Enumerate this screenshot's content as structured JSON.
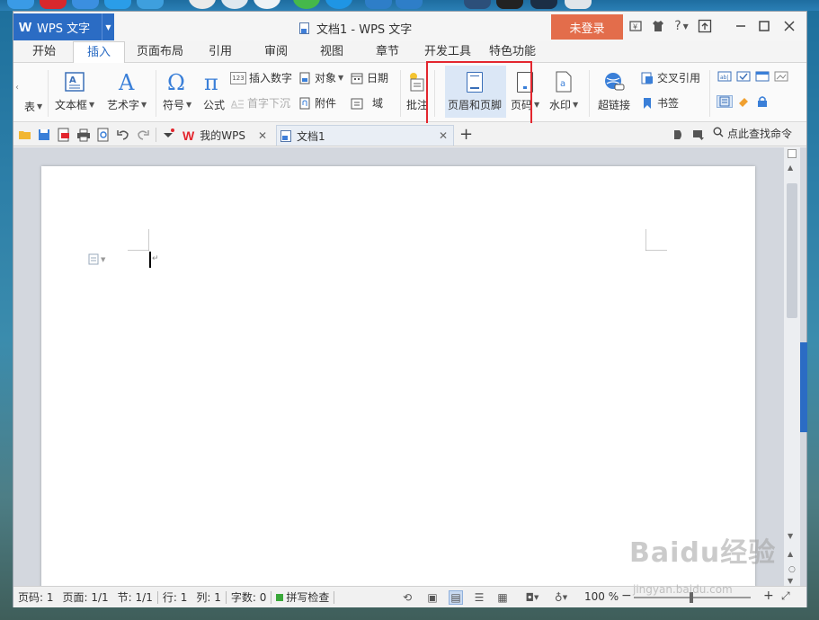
{
  "window": {
    "app_name": "WPS 文字",
    "doc_title": "文档1 - WPS 文字",
    "login_label": "未登录"
  },
  "menu": {
    "tabs": [
      "开始",
      "插入",
      "页面布局",
      "引用",
      "审阅",
      "视图",
      "章节",
      "开发工具",
      "特色功能"
    ],
    "active": "插入"
  },
  "ribbon": {
    "table_fragment": "表",
    "textbox": "文本框",
    "wordart": "艺术字",
    "symbol": "符号",
    "formula": "公式",
    "insert_number": "插入数字",
    "object": "对象",
    "date": "日期",
    "dropcap": "首字下沉",
    "attachment": "附件",
    "field": "域",
    "comment": "批注",
    "header_footer": "页眉和页脚",
    "page_number": "页码",
    "watermark": "水印",
    "hyperlink": "超链接",
    "crossref": "交叉引用",
    "bookmark": "书签",
    "number_icon_text": "123"
  },
  "quickbar": {
    "tab_mywps": "我的WPS",
    "tab_doc": "文档1",
    "search_cmd": "点此查找命令"
  },
  "status": {
    "page_code": "页码: 1",
    "page": "页面: 1/1",
    "section": "节: 1/1",
    "row": "行: 1",
    "col": "列: 1",
    "word_count": "字数: 0",
    "spellcheck": "拼写检查",
    "zoom": "100 %"
  },
  "watermark_text": {
    "main": "Baidu经验",
    "sub": "jingyan.baidu.com"
  },
  "colors": {
    "accent": "#2b6cc4",
    "login": "#e36d4b",
    "highlight": "#e3262e"
  }
}
